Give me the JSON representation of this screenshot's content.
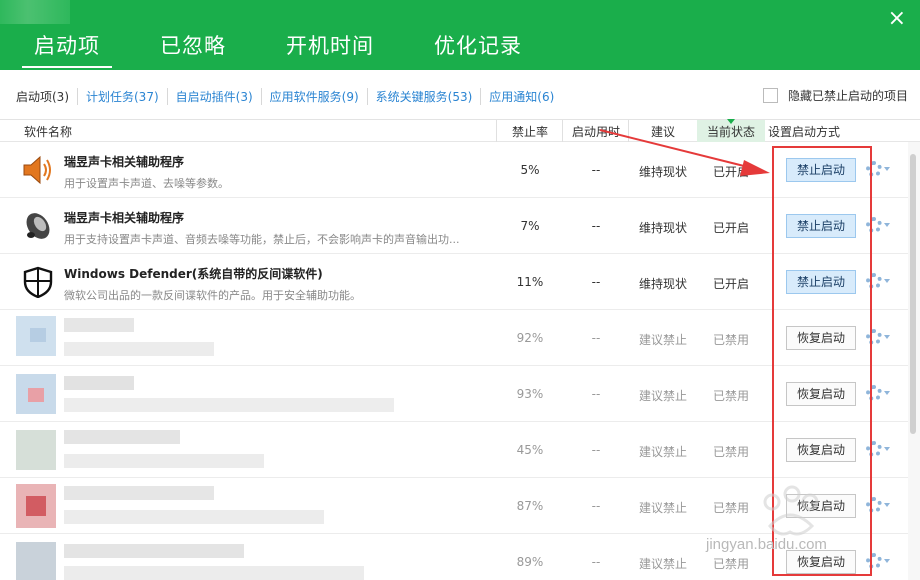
{
  "header": {
    "tabs": [
      {
        "label": "启动项",
        "active": true
      },
      {
        "label": "已忽略",
        "active": false
      },
      {
        "label": "开机时间",
        "active": false
      },
      {
        "label": "优化记录",
        "active": false
      }
    ],
    "close_glyph": "×",
    "accent_color": "#1aae4b"
  },
  "subtabs": [
    {
      "label": "启动项(3)"
    },
    {
      "label": "计划任务(37)"
    },
    {
      "label": "自启动插件(3)"
    },
    {
      "label": "应用软件服务(9)"
    },
    {
      "label": "系统关键服务(53)"
    },
    {
      "label": "应用通知(6)"
    }
  ],
  "hide_option": {
    "label": "隐藏已禁止启动的项目",
    "checked": false
  },
  "columns": {
    "name": "软件名称",
    "rate": "禁止率",
    "time": "启动用时",
    "suggestion": "建议",
    "state": "当前状态",
    "action": "设置启动方式"
  },
  "items": [
    {
      "name": "瑞昱声卡相关辅助程序",
      "desc": "用于设置声卡声道、去噪等参数。",
      "rate": "5%",
      "time": "--",
      "suggestion": "维持现状",
      "state": "已开启",
      "button": "禁止启动",
      "icon": "speaker-orange-icon"
    },
    {
      "name": "瑞昱声卡相关辅助程序",
      "desc": "用于支持设置声卡声道、音频去噪等功能，禁止后，不会影响声卡的声音输出功...",
      "rate": "7%",
      "time": "--",
      "suggestion": "维持现状",
      "state": "已开启",
      "button": "禁止启动",
      "icon": "speaker-black-icon"
    },
    {
      "name": "Windows Defender(系统自带的反间谍软件)",
      "desc": "微软公司出品的一款反间谍软件的产品。用于安全辅助功能。",
      "rate": "11%",
      "time": "--",
      "suggestion": "维持现状",
      "state": "已开启",
      "button": "禁止启动",
      "icon": "shield-icon"
    },
    {
      "rate": "92%",
      "time": "--",
      "suggestion": "建议禁止",
      "state": "已禁用",
      "button": "恢复启动"
    },
    {
      "rate": "93%",
      "time": "--",
      "suggestion": "建议禁止",
      "state": "已禁用",
      "button": "恢复启动"
    },
    {
      "rate": "45%",
      "time": "--",
      "suggestion": "建议禁止",
      "state": "已禁用",
      "button": "恢复启动"
    },
    {
      "rate": "87%",
      "time": "--",
      "suggestion": "建议禁止",
      "state": "已禁用",
      "button": "恢复启动"
    },
    {
      "rate": "89%",
      "time": "--",
      "suggestion": "建议禁止",
      "state": "已禁用",
      "button": "恢复启动"
    }
  ],
  "watermark": {
    "text": "jingyan.baidu.com"
  }
}
